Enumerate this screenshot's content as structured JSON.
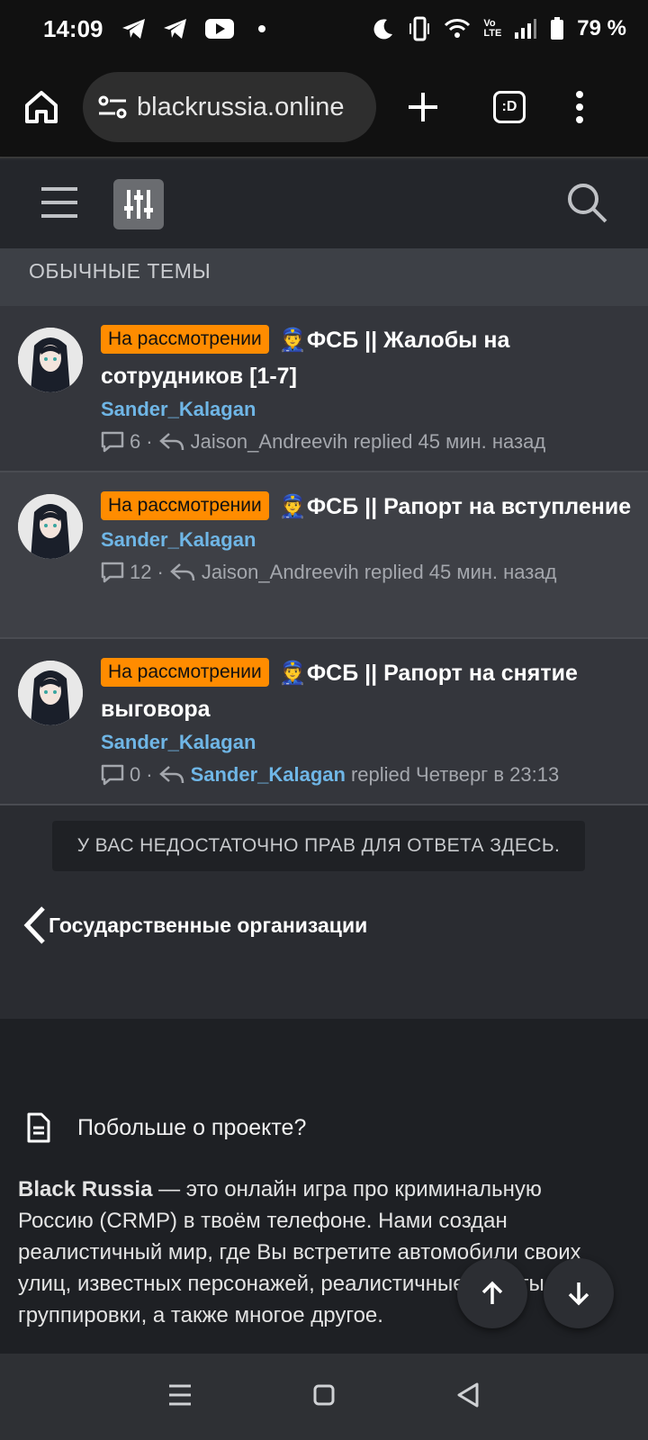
{
  "status": {
    "time": "14:09",
    "battery": "79 %"
  },
  "browser": {
    "url": "blackrussia.online",
    "tabs_label": ":D"
  },
  "section": {
    "title": "ОБЫЧНЫЕ ТЕМЫ"
  },
  "threads": [
    {
      "badge": "На рассмотрении",
      "emoji": "👮",
      "title": "ФСБ || Жалобы на сотрудников [1-7]",
      "author": "Sander_Kalagan",
      "replies": "6",
      "last_user": "Jaison_Andreevih",
      "replied_label": "replied",
      "time": "45 мин. назад"
    },
    {
      "badge": "На рассмотрении",
      "emoji": "👮",
      "title": "ФСБ || Рапорт на вступление",
      "author": "Sander_Kalagan",
      "replies": "12",
      "last_user": "Jaison_Andreevih",
      "replied_label": "replied",
      "time": "45 мин. назад"
    },
    {
      "badge": "На рассмотрении",
      "emoji": "👮",
      "title": "ФСБ || Рапорт на снятие выговора",
      "author": "Sander_Kalagan",
      "replies": "0",
      "last_user": "Sander_Kalagan",
      "replied_label": "replied",
      "time": "Четверг в 23:13"
    }
  ],
  "no_permission": "У ВАС НЕДОСТАТОЧНО ПРАВ ДЛЯ ОТВЕТА ЗДЕСЬ.",
  "back_link": "Государственные организации",
  "about": {
    "title": "Побольше о проекте?",
    "brand": "Black Russia",
    "text": " — это онлайн игра про криминальную Россию (CRMP) в твоём телефоне. Нами создан реалистичный мир, где Вы встретите автомобили своих улиц, известных персонажей, реалистичные работы и группировки, а также многое другое."
  },
  "colors": {
    "badge": "#ff8c00",
    "link": "#6fb6e6",
    "bg": "#2a2c31"
  }
}
